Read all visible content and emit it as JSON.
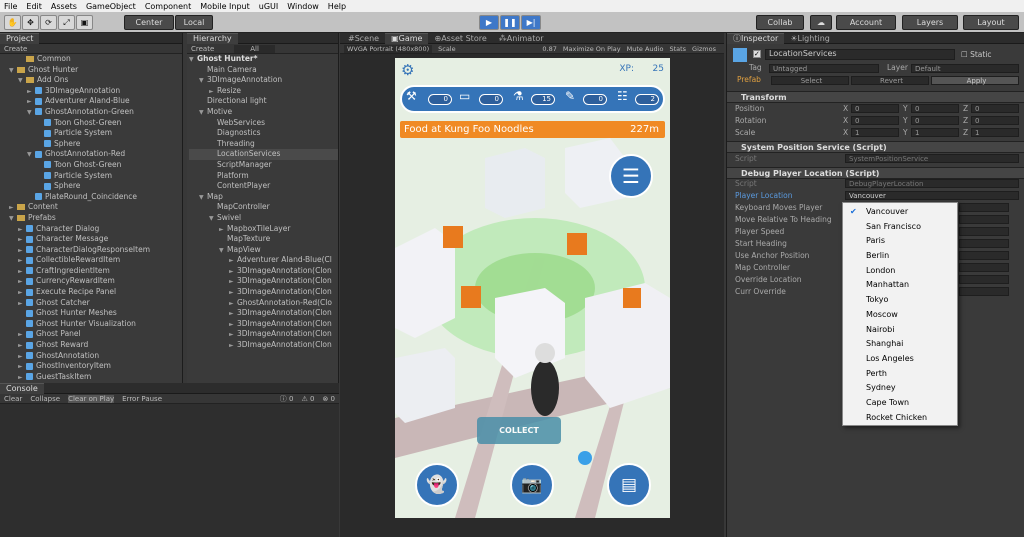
{
  "menu": [
    "File",
    "Edit",
    "Assets",
    "GameObject",
    "Component",
    "Mobile Input",
    "uGUI",
    "Window",
    "Help"
  ],
  "toolbar": {
    "center": "Center",
    "local": "Local",
    "collab": "Collab",
    "account": "Account",
    "layers": "Layers",
    "layout": "Layout"
  },
  "project": {
    "tab": "Project",
    "create": "Create",
    "items": [
      {
        "t": "Common",
        "d": 2,
        "k": "folder"
      },
      {
        "t": "Ghost Hunter",
        "d": 1,
        "k": "folder",
        "a": "▼"
      },
      {
        "t": "Add Ons",
        "d": 2,
        "k": "folder",
        "a": "▼"
      },
      {
        "t": "3DImageAnnotation",
        "d": 3,
        "k": "cube",
        "a": "►"
      },
      {
        "t": "Adventurer Aland-Blue",
        "d": 3,
        "k": "cube",
        "a": "►"
      },
      {
        "t": "GhostAnnotation-Green",
        "d": 3,
        "k": "cube",
        "a": "▼"
      },
      {
        "t": "Toon Ghost-Green",
        "d": 4,
        "k": "cube"
      },
      {
        "t": "Particle System",
        "d": 4,
        "k": "cube"
      },
      {
        "t": "Sphere",
        "d": 4,
        "k": "cube"
      },
      {
        "t": "GhostAnnotation-Red",
        "d": 3,
        "k": "cube",
        "a": "▼"
      },
      {
        "t": "Toon Ghost-Green",
        "d": 4,
        "k": "cube"
      },
      {
        "t": "Particle System",
        "d": 4,
        "k": "cube"
      },
      {
        "t": "Sphere",
        "d": 4,
        "k": "cube"
      },
      {
        "t": "PlateRound_Coincidence",
        "d": 3,
        "k": "cube"
      },
      {
        "t": "Content",
        "d": 1,
        "k": "folder",
        "a": "►"
      },
      {
        "t": "Prefabs",
        "d": 1,
        "k": "folder",
        "a": "▼"
      },
      {
        "t": "Character Dialog",
        "d": 2,
        "k": "cube",
        "a": "►"
      },
      {
        "t": "Character Message",
        "d": 2,
        "k": "cube",
        "a": "►"
      },
      {
        "t": "CharacterDialogResponseItem",
        "d": 2,
        "k": "cube",
        "a": "►"
      },
      {
        "t": "CollectibleRewardItem",
        "d": 2,
        "k": "cube",
        "a": "►"
      },
      {
        "t": "CraftIngredientItem",
        "d": 2,
        "k": "cube",
        "a": "►"
      },
      {
        "t": "CurrencyRewardItem",
        "d": 2,
        "k": "cube",
        "a": "►"
      },
      {
        "t": "Execute Recipe Panel",
        "d": 2,
        "k": "cube",
        "a": "►"
      },
      {
        "t": "Ghost Catcher",
        "d": 2,
        "k": "cube",
        "a": "►"
      },
      {
        "t": "Ghost Hunter Meshes",
        "d": 2,
        "k": "cube"
      },
      {
        "t": "Ghost Hunter Visualization",
        "d": 2,
        "k": "cube"
      },
      {
        "t": "Ghost Panel",
        "d": 2,
        "k": "cube",
        "a": "►"
      },
      {
        "t": "Ghost Reward",
        "d": 2,
        "k": "cube",
        "a": "►"
      },
      {
        "t": "GhostAnnotation",
        "d": 2,
        "k": "cube",
        "a": "►"
      },
      {
        "t": "GhostInventoryItem",
        "d": 2,
        "k": "cube",
        "a": "►"
      },
      {
        "t": "GuestTaskItem",
        "d": 2,
        "k": "cube",
        "a": "►"
      }
    ]
  },
  "hierarchy": {
    "tab": "Hierarchy",
    "create": "Create",
    "search": "All",
    "scene": "Ghost Hunter*",
    "items": [
      {
        "t": "Main Camera",
        "d": 1
      },
      {
        "t": "3DImageAnnotation",
        "d": 1,
        "a": "▼"
      },
      {
        "t": "Resize",
        "d": 2,
        "a": "►"
      },
      {
        "t": "Directional light",
        "d": 1
      },
      {
        "t": "Motive",
        "d": 1,
        "a": "▼"
      },
      {
        "t": "WebServices",
        "d": 2
      },
      {
        "t": "Diagnostics",
        "d": 2
      },
      {
        "t": "Threading",
        "d": 2
      },
      {
        "t": "LocationServices",
        "d": 2,
        "sel": true
      },
      {
        "t": "ScriptManager",
        "d": 2
      },
      {
        "t": "Platform",
        "d": 2
      },
      {
        "t": "ContentPlayer",
        "d": 2
      },
      {
        "t": "Map",
        "d": 1,
        "a": "▼"
      },
      {
        "t": "MapController",
        "d": 2
      },
      {
        "t": "Swivel",
        "d": 2,
        "a": "▼"
      },
      {
        "t": "MapboxTileLayer",
        "d": 3,
        "a": "►"
      },
      {
        "t": "MapTexture",
        "d": 3
      },
      {
        "t": "MapView",
        "d": 3,
        "a": "▼"
      },
      {
        "t": "Adventurer Aland-Blue(Cl",
        "d": 4,
        "a": "►"
      },
      {
        "t": "3DImageAnnotation(Clon",
        "d": 4,
        "a": "►"
      },
      {
        "t": "3DImageAnnotation(Clon",
        "d": 4,
        "a": "►"
      },
      {
        "t": "3DImageAnnotation(Clon",
        "d": 4,
        "a": "►"
      },
      {
        "t": "GhostAnnotation-Red(Clo",
        "d": 4,
        "a": "►"
      },
      {
        "t": "3DImageAnnotation(Clon",
        "d": 4,
        "a": "►"
      },
      {
        "t": "3DImageAnnotation(Clon",
        "d": 4,
        "a": "►"
      },
      {
        "t": "3DImageAnnotation(Clon",
        "d": 4,
        "a": "►"
      },
      {
        "t": "3DImageAnnotation(Clon",
        "d": 4,
        "a": "►"
      }
    ]
  },
  "console": {
    "tab": "Console",
    "clear": "Clear",
    "collapse": "Collapse",
    "clear_on_play": "Clear on Play",
    "error_pause": "Error Pause",
    "c1": "0",
    "c2": "0",
    "c3": "0"
  },
  "game": {
    "tabs": [
      "Scene",
      "Game",
      "Asset Store",
      "Animator"
    ],
    "resolution": "WVGA Portrait (480x800)",
    "scale": "Scale",
    "scale_val": "0.87",
    "maximize": "Maximize On Play",
    "mute": "Mute Audio",
    "stats": "Stats",
    "gizmos": "Gizmos"
  },
  "phone": {
    "xp_label": "XP:",
    "xp": "25",
    "counts": [
      "0",
      "0",
      "15",
      "0",
      "2"
    ],
    "banner": "Food at Kung Foo Noodles",
    "distance": "227m",
    "collect": "COLLECT"
  },
  "inspector": {
    "tabs": [
      "Inspector",
      "Lighting"
    ],
    "object_name": "LocationServices",
    "static": "Static",
    "tag_label": "Tag",
    "tag": "Untagged",
    "layer_label": "Layer",
    "layer": "Default",
    "prefab": "Prefab",
    "select": "Select",
    "revert": "Revert",
    "apply": "Apply",
    "transform": "Transform",
    "position": "Position",
    "rotation": "Rotation",
    "scale": "Scale",
    "pos": [
      "0",
      "0",
      "0"
    ],
    "rot": [
      "0",
      "0",
      "0"
    ],
    "scl": [
      "1",
      "1",
      "1"
    ],
    "comp1": "System Position Service (Script)",
    "script_label": "Script",
    "script1": "SystemPositionService",
    "comp2": "Debug Player Location (Script)",
    "script2": "DebugPlayerLocation",
    "player_location": "Player Location",
    "player_location_val": "Vancouver",
    "props": [
      "Keyboard Moves Player",
      "Move Relative To Heading",
      "Player Speed",
      "Start Heading",
      "Use Anchor Position",
      "Map Controller",
      "Override Location",
      "Curr Override"
    ]
  },
  "dropdown": [
    "Vancouver",
    "San Francisco",
    "Paris",
    "Berlin",
    "London",
    "Manhattan",
    "Tokyo",
    "Moscow",
    "Nairobi",
    "Shanghai",
    "Los Angeles",
    "Perth",
    "Sydney",
    "Cape Town",
    "Rocket Chicken"
  ],
  "colors": {
    "accent": "#3574b8",
    "banner": "#f08a24",
    "selected": "#1b6fd8"
  }
}
